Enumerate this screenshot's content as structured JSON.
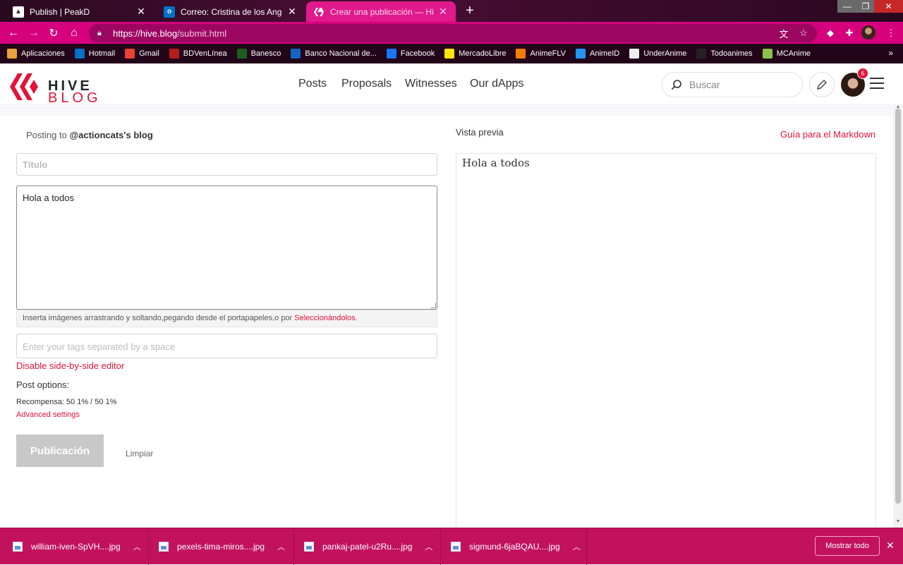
{
  "browser": {
    "tabs": [
      {
        "title": "Publish | PeakD",
        "favicon": "peakd-icon"
      },
      {
        "title": "Correo: Cristina de los Angeles T",
        "favicon": "outlook-icon"
      },
      {
        "title": "Crear una publicación — Hive",
        "favicon": "hive-icon"
      }
    ],
    "url_host": "https://hive.blog",
    "url_path": "/submit.html",
    "bookmarks": [
      {
        "label": "Aplicaciones",
        "icon": "apps-grid-icon",
        "color": "#e8a33d"
      },
      {
        "label": "Hotmail",
        "icon": "outlook-icon",
        "color": "#0072c6"
      },
      {
        "label": "Gmail",
        "icon": "gmail-icon",
        "color": "#ea4335"
      },
      {
        "label": "BDVenLínea",
        "icon": "bank-icon",
        "color": "#b71c1c"
      },
      {
        "label": "Banesco",
        "icon": "banesco-icon",
        "color": "#1b5e20"
      },
      {
        "label": "Banco Nacional de...",
        "icon": "bank-icon",
        "color": "#1565c0"
      },
      {
        "label": "Facebook",
        "icon": "facebook-icon",
        "color": "#1877f2"
      },
      {
        "label": "MercadoLibre",
        "icon": "handshake-icon",
        "color": "#ffe600"
      },
      {
        "label": "AnimeFLV",
        "icon": "animeflv-icon",
        "color": "#f57c00"
      },
      {
        "label": "AnimeID",
        "icon": "animeid-icon",
        "color": "#2196f3"
      },
      {
        "label": "UnderAnime",
        "icon": "underanime-icon",
        "color": "#eeeeee"
      },
      {
        "label": "Todoanimes",
        "icon": "todoanimes-icon",
        "color": "#222222"
      },
      {
        "label": "MCAnime",
        "icon": "mcanime-icon",
        "color": "#8bc34a"
      }
    ]
  },
  "site": {
    "logo_line1": "HIVE",
    "logo_line2": "BLOG",
    "nav": [
      "Posts",
      "Proposals",
      "Witnesses",
      "Our dApps"
    ],
    "search_placeholder": "Buscar",
    "notification_count": "6"
  },
  "editor": {
    "posting_prefix": "Posting to ",
    "posting_blog": "@actioncats's blog",
    "title_placeholder": "Título",
    "body_value": "Hola a todos",
    "drop_hint": "Inserta imágenes arrastrando y soltando,pegando desde el portapapeles,o por ",
    "drop_link": "Seleccionándolos.",
    "tags_placeholder": "Enter your tags separated by a space",
    "disable_side_by_side": "Disable side-by-side editor",
    "post_options": "Post options:",
    "reward": "Recompensa: 50 1% / 50 1%",
    "advanced": "Advanced settings",
    "publish": "Publicación",
    "clear": "Limpiar"
  },
  "preview": {
    "label": "Vista previa",
    "markdown_guide": "Guía para el Markdown",
    "content": "Hola a todos"
  },
  "downloads": {
    "files": [
      "william-iven-SpVH....jpg",
      "pexels-tima-miros....jpg",
      "pankaj-patel-u2Ru....jpg",
      "sigmund-6jaBQAU....jpg"
    ],
    "show_all": "Mostrar todo"
  },
  "colors": {
    "hive_red": "#e31337",
    "chrome_pink": "#d6007f"
  }
}
